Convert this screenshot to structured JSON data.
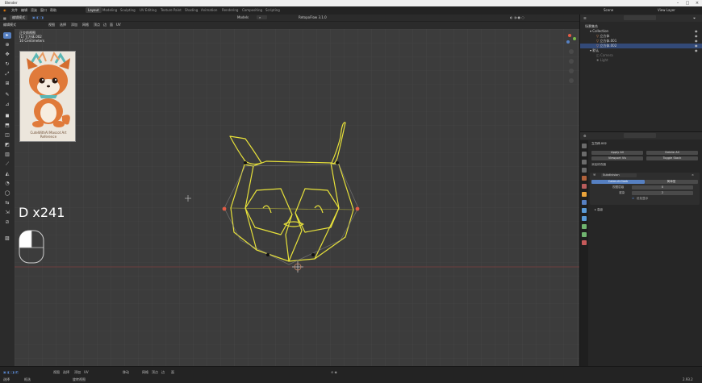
{
  "window": {
    "title": "Blender"
  },
  "menubar": {
    "items": [
      "文件",
      "编辑",
      "渲染",
      "窗口",
      "帮助"
    ],
    "tabs": [
      "Layout",
      "Modeling",
      "Sculpting",
      "UV Editing",
      "Texture Paint",
      "Shading",
      "Animation",
      "Rendering",
      "Compositing",
      "Scripting"
    ],
    "active_tab": "Layout",
    "scene_label": "Scene",
    "view_layer_label": "View Layer"
  },
  "viewport_header": {
    "mode": "编辑模式",
    "menus": [
      "视图",
      "选择",
      "添加",
      "网格",
      "顶点",
      "边",
      "面",
      "UV"
    ],
    "pivot": "Models",
    "snap_label": "RetopoFlow 3.1.0",
    "transform_orientation": "全局"
  },
  "viewport_info": {
    "line1": "正交前视图",
    "line2": "(1) 立方体.002",
    "line3": "10 Centimeters"
  },
  "reference_image": {
    "caption": "CuteWithAl Mascot Art Reference"
  },
  "key_hud": {
    "text": "D x241"
  },
  "outliner": {
    "search_placeholder": "",
    "rows": [
      {
        "label": "场景集合",
        "indent": 0,
        "selected": false,
        "dim": false
      },
      {
        "label": "Collection",
        "indent": 1,
        "selected": false,
        "dim": false
      },
      {
        "label": "立方体",
        "indent": 2,
        "selected": false,
        "dim": false
      },
      {
        "label": "立方体.001",
        "indent": 2,
        "selected": false,
        "dim": false
      },
      {
        "label": "立方体.002",
        "indent": 2,
        "selected": true,
        "dim": false
      },
      {
        "label": "默认",
        "indent": 1,
        "selected": false,
        "dim": false
      },
      {
        "label": "Camera",
        "indent": 2,
        "selected": false,
        "dim": true
      },
      {
        "label": "Light",
        "indent": 2,
        "selected": false,
        "dim": true
      }
    ]
  },
  "properties": {
    "object_name": "立方体.002",
    "apply_all": "Apply All",
    "delete_all": "Delete All",
    "viewport_vis": "Viewport Vis",
    "toggle_stack": "Toggle Stack",
    "add_modifier": "添加修改器",
    "modifier_name": "Subdivision",
    "tab_catmull": "Catmull-Clark",
    "tab_simple": "简单型",
    "field1_label": "视图层级",
    "field1_value": "0",
    "field2_label": "渲染",
    "field2_value": "2",
    "optimal_display": "优化显示",
    "advanced": "高级"
  },
  "statusbar": {
    "left_items": [
      "选择",
      "框选",
      "旋转视图"
    ],
    "center_hint": "移动",
    "version": "2.93.2",
    "middle_items": [
      "视图",
      "选择",
      "添加",
      "网格",
      "顶点",
      "边",
      "面",
      "UV"
    ]
  },
  "colors": {
    "accent": "#5680c2",
    "wire_yellow": "#e8e23a",
    "selected_vertex": "#e15b45",
    "axis_red": "#8b3b3b"
  }
}
